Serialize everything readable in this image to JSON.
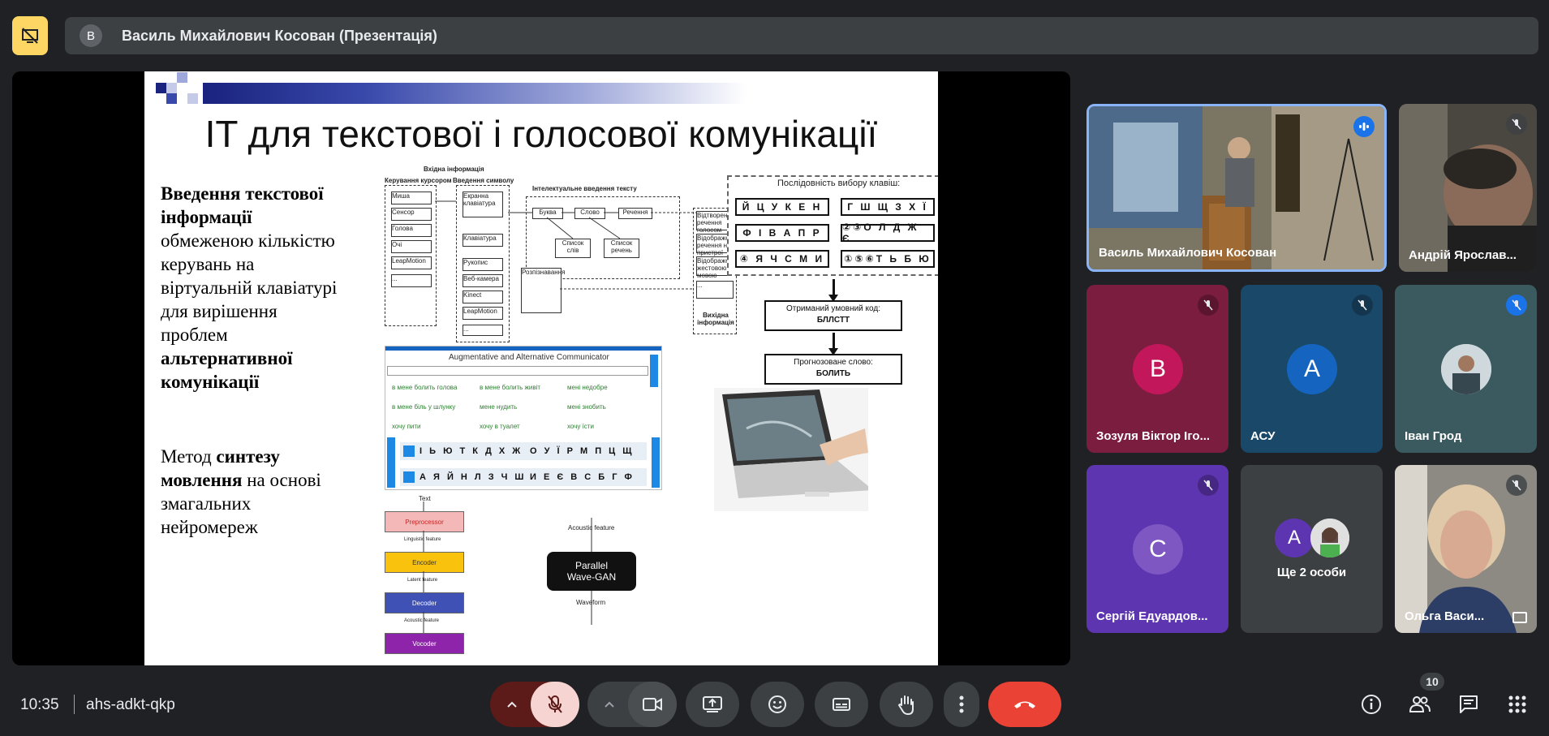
{
  "meeting": {
    "presenter_title": "Василь Михайлович Косован (Презентація)",
    "presenter_initial": "В",
    "time": "10:35",
    "code": "ahs-adkt-qkp",
    "participant_count": "10"
  },
  "slide": {
    "title": "IT для текстової і голосової комунікації",
    "left_text_1_bold_a": "Введення текстової інформації",
    "left_text_1_normal": "обмеженою кількістю керувань  на віртуальній клавіатурі для вирішення проблем",
    "left_text_1_bold_b": "альтернативної комунікації",
    "left_text_2_normal_a": "Метод",
    "left_text_2_bold": "синтезу мовлення",
    "left_text_2_normal_b": "на основі змагальних нейромереж",
    "diagram": {
      "input_header": "Вхідна інформація",
      "cursor_header": "Керування курсором",
      "symbol_header": "Введення символу",
      "intel_header": "Інтелектуальне введення тексту",
      "output_header": "Вихідна інформація",
      "cursor_items": [
        "Миша",
        "Сенсор",
        "Голова",
        "Очі",
        "LeapMotion",
        "..."
      ],
      "symbol_items": [
        "Екранна клавіатура",
        "Клавіатура",
        "Рукопис",
        "Веб-камера",
        "Kinect",
        "LeapMotion",
        "..."
      ],
      "flow_items": [
        "Буква",
        "Слово",
        "Речення"
      ],
      "list_items": [
        "Список слів",
        "Список речень"
      ],
      "recognize": "Розпізнавання",
      "output_items": [
        "Відтворення речення голосом",
        "Відображення речення на пристрої",
        "Відображення жестовою мовою",
        "..."
      ]
    },
    "keys_header": "Послідовність вибору клавіш:",
    "keys": [
      "Й Ц У К Е Н",
      "Г Ш Щ З Х Ї",
      "Ф І В А П Р",
      "②③О Л Д Ж Є",
      "④ Я Ч С М И",
      "①⑤⑥Т Ь Б Ю"
    ],
    "code_label": "Отриманий умовний код:",
    "code_value": "БЛЛСТТ",
    "predict_label": "Прогнозоване слово:",
    "predict_value": "БОЛИТЬ",
    "aac": {
      "title": "Augmentative and Alternative Communicator",
      "phrases": [
        "в мене болить голова",
        "в мене болить живіт",
        "мені недобре",
        "в мене біль у шлунку",
        "мене нудить",
        "мені знобить",
        "хочу пити",
        "хочу в туалет",
        "хочу їсти"
      ],
      "row1a": "І Ь Ю Т К Д Х Ж",
      "row1b": "О У Ї Р М П Ц Щ",
      "row2a": "А Я Й Н Л З Ч Ш",
      "row2b": "И Е Є В С Б Г Ф"
    },
    "nn": {
      "text": "Text",
      "preprocessor": "Preprocessor",
      "ling": "Linguistic feature",
      "encoder": "Encoder",
      "latent": "Latent feature",
      "decoder": "Decoder",
      "acoustic_small": "Acoustic feature",
      "vocoder": "Vocoder",
      "acoustic": "Acoustic feature",
      "gan": "Parallel Wave-GAN",
      "waveform": "Waveform"
    }
  },
  "participants": [
    {
      "name": "Василь Михайлович Косован",
      "kind": "video-speaking"
    },
    {
      "name": "Андрій Ярослав...",
      "kind": "video-muted"
    },
    {
      "name": "Зозуля Віктор Іго...",
      "initial": "В",
      "bg": "#7b1d3e",
      "avatar": "#c2185b"
    },
    {
      "name": "АСУ",
      "initial": "А",
      "bg": "#1a4868",
      "avatar": "#1565c0"
    },
    {
      "name": "Іван Грод",
      "bg": "#3b5a5f"
    },
    {
      "name": "Сергій Едуардов...",
      "initial": "С",
      "bg": "#5e35b1",
      "avatar": "#7e57c2"
    },
    {
      "name": "Ще 2 особи",
      "initial": "А"
    },
    {
      "name": "Ольга Васи...",
      "kind": "video-muted"
    }
  ],
  "colors": {
    "end_call": "#ea4335",
    "mic_off": "#f6d4d2",
    "accent_yellow": "#fdd663"
  }
}
